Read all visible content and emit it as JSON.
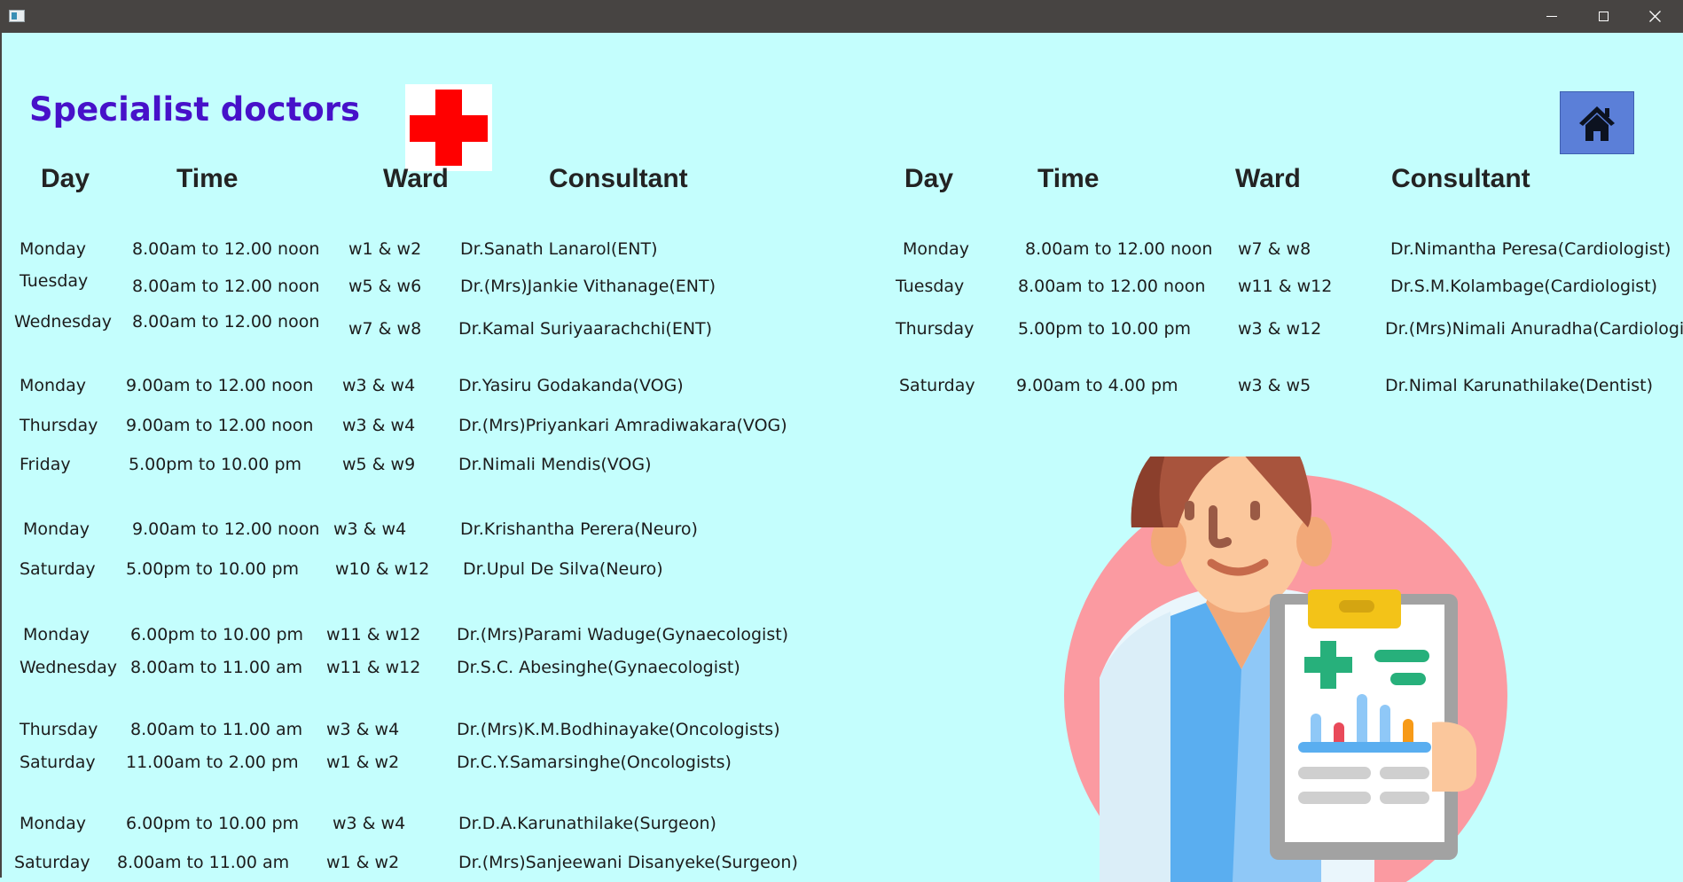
{
  "window": {
    "controls": [
      "minimize",
      "maximize",
      "close"
    ]
  },
  "page": {
    "title": "Specialist doctors"
  },
  "home": {
    "icon": "home-icon"
  },
  "colors": {
    "background": "#c4fefd",
    "title": "#4711c9",
    "cross": "#ff0000",
    "home_button": "#5b7fd8"
  },
  "headers": {
    "day": "Day",
    "time": "Time",
    "ward": "Ward",
    "consultant": "Consultant"
  },
  "left_rows": [
    {
      "day": "Monday",
      "time": "8.00am to 12.00 noon",
      "ward": "w1 & w2",
      "consultant": "Dr.Sanath Lanarol(ENT)"
    },
    {
      "day": "Tuesday",
      "time": "8.00am to 12.00 noon",
      "ward": "w5 & w6",
      "consultant": "Dr.(Mrs)Jankie Vithanage(ENT)"
    },
    {
      "day": "Wednesday",
      "time": "8.00am to 12.00 noon",
      "ward": "w7 & w8",
      "consultant": "Dr.Kamal Suriyaarachchi(ENT)"
    },
    {
      "day": "Monday",
      "time": "9.00am to 12.00 noon",
      "ward": "w3 & w4",
      "consultant": "Dr.Yasiru Godakanda(VOG)"
    },
    {
      "day": "Thursday",
      "time": "9.00am to 12.00 noon",
      "ward": "w3 & w4",
      "consultant": "Dr.(Mrs)Priyankari Amradiwakara(VOG)"
    },
    {
      "day": "Friday",
      "time": "5.00pm to 10.00 pm",
      "ward": "w5 & w9",
      "consultant": "Dr.Nimali Mendis(VOG)"
    },
    {
      "day": "Monday",
      "time": "9.00am to 12.00 noon",
      "ward": "w3 & w4",
      "consultant": "Dr.Krishantha Perera(Neuro)"
    },
    {
      "day": "Saturday",
      "time": "5.00pm to 10.00 pm",
      "ward": "w10 & w12",
      "consultant": "Dr.Upul De Silva(Neuro)"
    },
    {
      "day": "Monday",
      "time": "6.00pm to 10.00 pm",
      "ward": "w11 & w12",
      "consultant": "Dr.(Mrs)Parami Waduge(Gynaecologist)"
    },
    {
      "day": "Wednesday",
      "time": "8.00am to 11.00 am",
      "ward": "w11 & w12",
      "consultant": "Dr.S.C. Abesinghe(Gynaecologist)"
    },
    {
      "day": "Thursday",
      "time": "8.00am to 11.00 am",
      "ward": "w3 & w4",
      "consultant": "Dr.(Mrs)K.M.Bodhinayake(Oncologists)"
    },
    {
      "day": "Saturday",
      "time": "11.00am to 2.00 pm",
      "ward": "w1 & w2",
      "consultant": "Dr.C.Y.Samarsinghe(Oncologists)"
    },
    {
      "day": "Monday",
      "time": "6.00pm to 10.00 pm",
      "ward": "w3 & w4",
      "consultant": "Dr.D.A.Karunathilake(Surgeon)"
    },
    {
      "day": "Saturday",
      "time": "8.00am to 11.00 am",
      "ward": "w1 & w2",
      "consultant": "Dr.(Mrs)Sanjeewani Disanyeke(Surgeon)"
    }
  ],
  "right_rows": [
    {
      "day": "Monday",
      "time": "8.00am to 12.00 noon",
      "ward": "w7 & w8",
      "consultant": "Dr.Nimantha Peresa(Cardiologist)"
    },
    {
      "day": "Tuesday",
      "time": "8.00am to 12.00 noon",
      "ward": "w11 & w12",
      "consultant": "Dr.S.M.Kolambage(Cardiologist)"
    },
    {
      "day": "Thursday",
      "time": "5.00pm to 10.00 pm",
      "ward": "w3 & w12",
      "consultant": "Dr.(Mrs)Nimali Anuradha(Cardiologist)"
    },
    {
      "day": "Saturday",
      "time": "9.00am to 4.00 pm",
      "ward": "w3 & w5",
      "consultant": "Dr.Nimal Karunathilake(Dentist)"
    }
  ]
}
